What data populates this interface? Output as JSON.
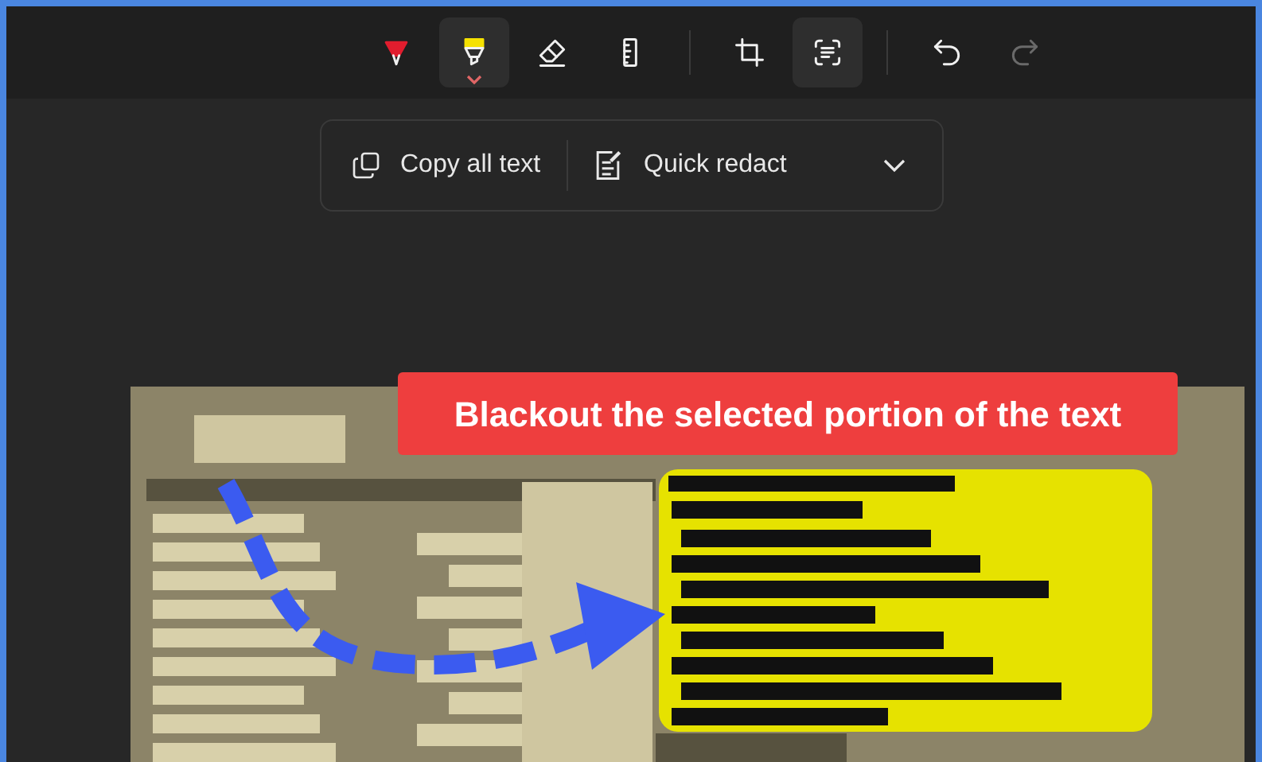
{
  "toolbar": {
    "tools": [
      {
        "kind": "pen",
        "selected": false,
        "disabled": false
      },
      {
        "kind": "highlighter",
        "selected": true,
        "disabled": false
      },
      {
        "kind": "eraser",
        "selected": false,
        "disabled": false
      },
      {
        "kind": "ruler",
        "selected": false,
        "disabled": false
      },
      {
        "kind": "divider"
      },
      {
        "kind": "crop",
        "selected": false,
        "disabled": false
      },
      {
        "kind": "text-actions",
        "selected": true,
        "disabled": false
      },
      {
        "kind": "divider"
      },
      {
        "kind": "undo",
        "selected": false,
        "disabled": false
      },
      {
        "kind": "redo",
        "selected": false,
        "disabled": true
      }
    ]
  },
  "text_actions": {
    "copy_all_text": "Copy all text",
    "quick_redact": "Quick redact"
  },
  "callout": "Blackout the selected portion of the text"
}
